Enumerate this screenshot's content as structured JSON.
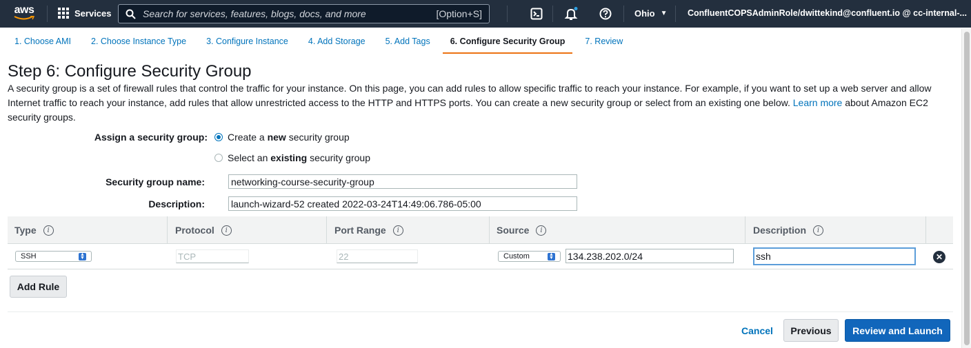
{
  "topnav": {
    "logo_text": "aws",
    "services_label": "Services",
    "search_placeholder": "Search for services, features, blogs, docs, and more",
    "search_shortcut": "[Option+S]",
    "region": "Ohio",
    "account": "ConfluentCOPSAdminRole/dwittekind@confluent.io @ cc-internal-..."
  },
  "tabs": [
    {
      "label": "1. Choose AMI",
      "active": false
    },
    {
      "label": "2. Choose Instance Type",
      "active": false
    },
    {
      "label": "3. Configure Instance",
      "active": false
    },
    {
      "label": "4. Add Storage",
      "active": false
    },
    {
      "label": "5. Add Tags",
      "active": false
    },
    {
      "label": "6. Configure Security Group",
      "active": true
    },
    {
      "label": "7. Review",
      "active": false
    }
  ],
  "page": {
    "title": "Step 6: Configure Security Group",
    "intro_before_link": "A security group is a set of firewall rules that control the traffic for your instance. On this page, you can add rules to allow specific traffic to reach your instance. For example, if you want to set up a web server and allow Internet traffic to reach your instance, add rules that allow unrestricted access to the HTTP and HTTPS ports. You can create a new security group or select from an existing one below.",
    "intro_link": "Learn more",
    "intro_after_link": "about Amazon EC2 security groups."
  },
  "form": {
    "assign_label": "Assign a security group:",
    "option_create_pre": "Create a",
    "option_create_bold": "new",
    "option_create_post": "security group",
    "option_select_pre": "Select an",
    "option_select_bold": "existing",
    "option_select_post": "security group",
    "name_label": "Security group name:",
    "name_value": "networking-course-security-group",
    "description_label": "Description:",
    "description_value": "launch-wizard-52 created 2022-03-24T14:49:06.786-05:00"
  },
  "table": {
    "headers": {
      "type": "Type",
      "protocol": "Protocol",
      "port_range": "Port Range",
      "source": "Source",
      "description": "Description"
    },
    "info_glyph": "i",
    "rows": [
      {
        "type": "SSH",
        "protocol": "TCP",
        "port_range": "22",
        "source_mode": "Custom",
        "source_cidr": "134.238.202.0/24",
        "description": "ssh"
      }
    ]
  },
  "buttons": {
    "add_rule": "Add Rule",
    "cancel": "Cancel",
    "previous": "Previous",
    "review_launch": "Review and Launch"
  },
  "colors": {
    "nav_bg": "#232f3e",
    "link": "#0073bb",
    "active_tab_underline": "#ec7211",
    "primary_button": "#1166bb"
  }
}
